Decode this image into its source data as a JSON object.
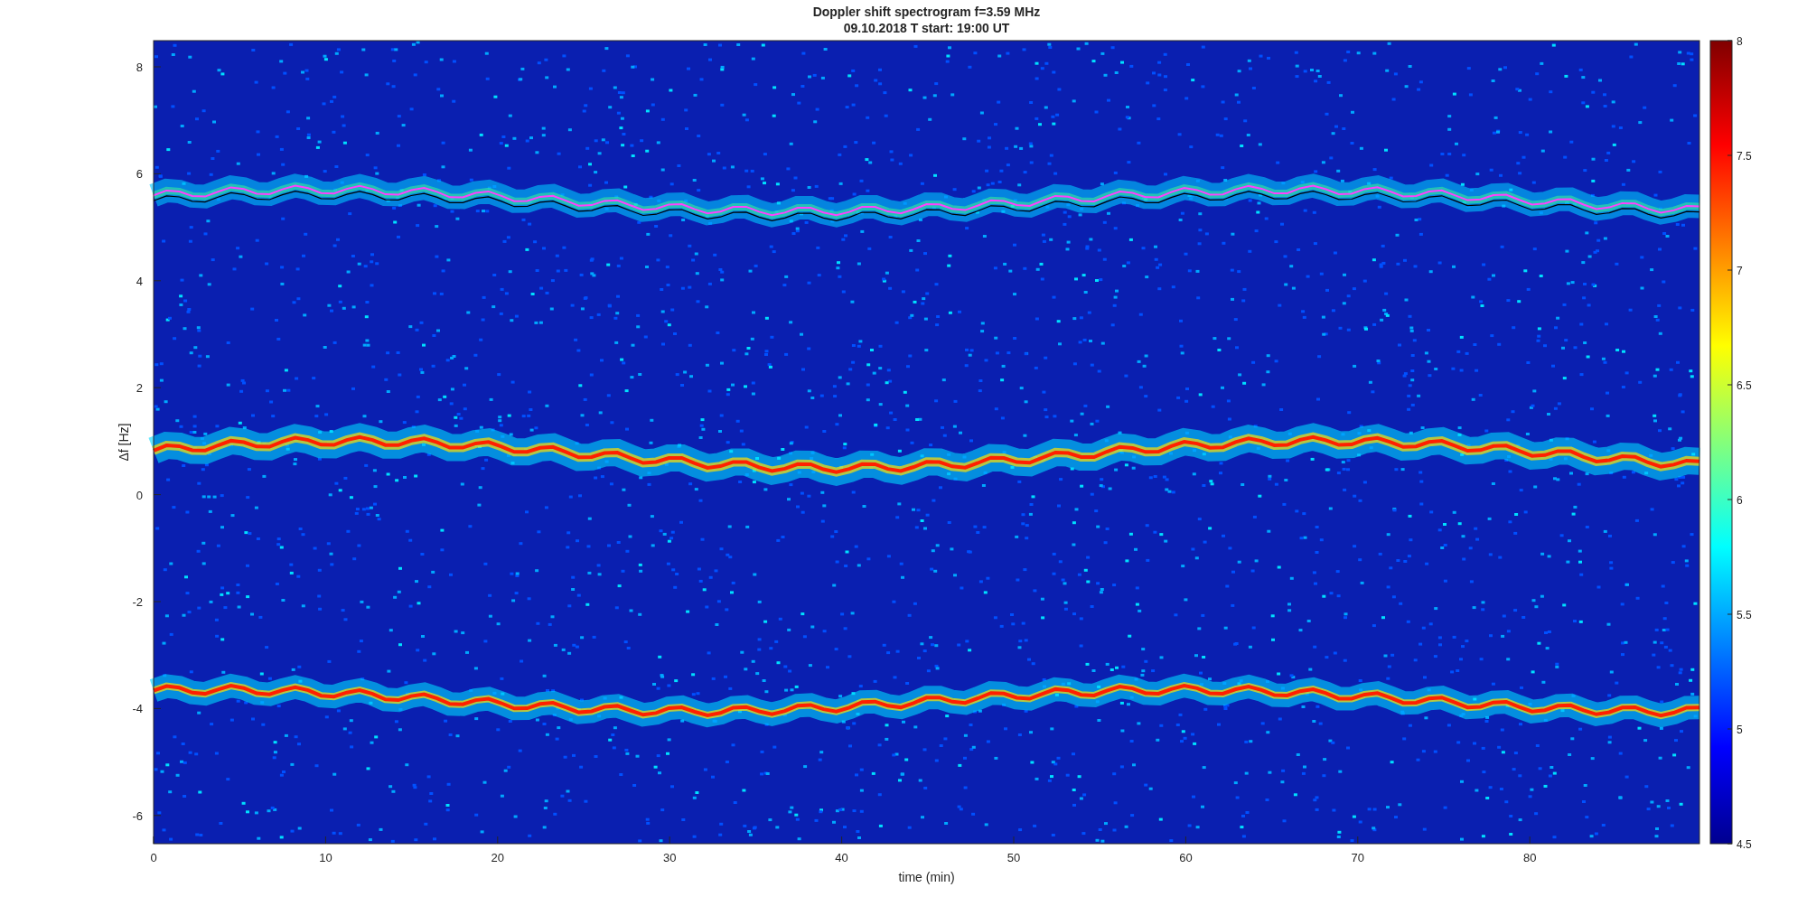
{
  "title": [
    "Doppler shift spectrogram f=3.59 MHz",
    "09.10.2018   T start: 19:00 UT"
  ],
  "y_axis": {
    "label": "Δf [Hz]",
    "ticks": [
      "8",
      "6",
      "4",
      "2",
      "0",
      "-2",
      "-4",
      "-6"
    ]
  },
  "x_axis": {
    "label": "time (min)",
    "ticks": [
      "0",
      "10",
      "20",
      "30",
      "40",
      "50",
      "60",
      "70",
      "80"
    ]
  },
  "colorbar": {
    "ticks": [
      "8",
      "7.5",
      "7",
      "6.5",
      "6",
      "5.5",
      "5",
      "4.5"
    ]
  }
}
